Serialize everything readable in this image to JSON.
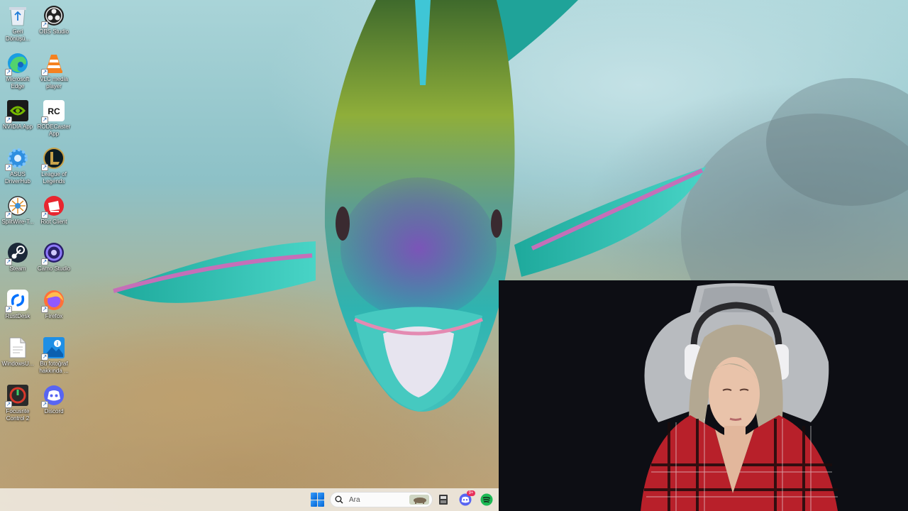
{
  "desktop": {
    "icons": [
      {
        "label": "Geri Dönüşü...",
        "icon": "recycle-bin-icon"
      },
      {
        "label": "OBS Studio",
        "icon": "obs-studio-icon"
      },
      {
        "label": "Microsoft Edge",
        "icon": "edge-icon"
      },
      {
        "label": "VLC media player",
        "icon": "vlc-icon"
      },
      {
        "label": "NVIDIA App",
        "icon": "nvidia-icon"
      },
      {
        "label": "RODECaster App",
        "icon": "rodecaster-icon"
      },
      {
        "label": "ASUS DriverHub",
        "icon": "asus-driverhub-icon"
      },
      {
        "label": "League of Legends",
        "icon": "league-of-legends-icon"
      },
      {
        "label": "SplitWire-T...",
        "icon": "splitwire-icon"
      },
      {
        "label": "Riot Client",
        "icon": "riot-client-icon"
      },
      {
        "label": "Steam",
        "icon": "steam-icon"
      },
      {
        "label": "Camo Studio",
        "icon": "camo-studio-icon"
      },
      {
        "label": "RustDesk",
        "icon": "rustdesk-icon"
      },
      {
        "label": "Firefox",
        "icon": "firefox-icon"
      },
      {
        "label": "WindowsU...",
        "icon": "document-icon"
      },
      {
        "label": "Bu fotoğraf hakkında ...",
        "icon": "photo-info-icon"
      },
      {
        "label": "Focusrite Control 2",
        "icon": "focusrite-icon"
      },
      {
        "label": "Discord",
        "icon": "discord-icon"
      }
    ]
  },
  "taskbar": {
    "search_placeholder": "Ara",
    "discord_badge": "9+",
    "items": [
      "windows-start-icon",
      "search-icon",
      "file-explorer-icon",
      "discord-icon",
      "spotify-icon"
    ]
  },
  "colors": {
    "taskbar_bg": "#eee8de",
    "accent": "#0078d4",
    "discord": "#5865f2",
    "spotify": "#1db954",
    "webcam_bg": "#0d0e14"
  }
}
